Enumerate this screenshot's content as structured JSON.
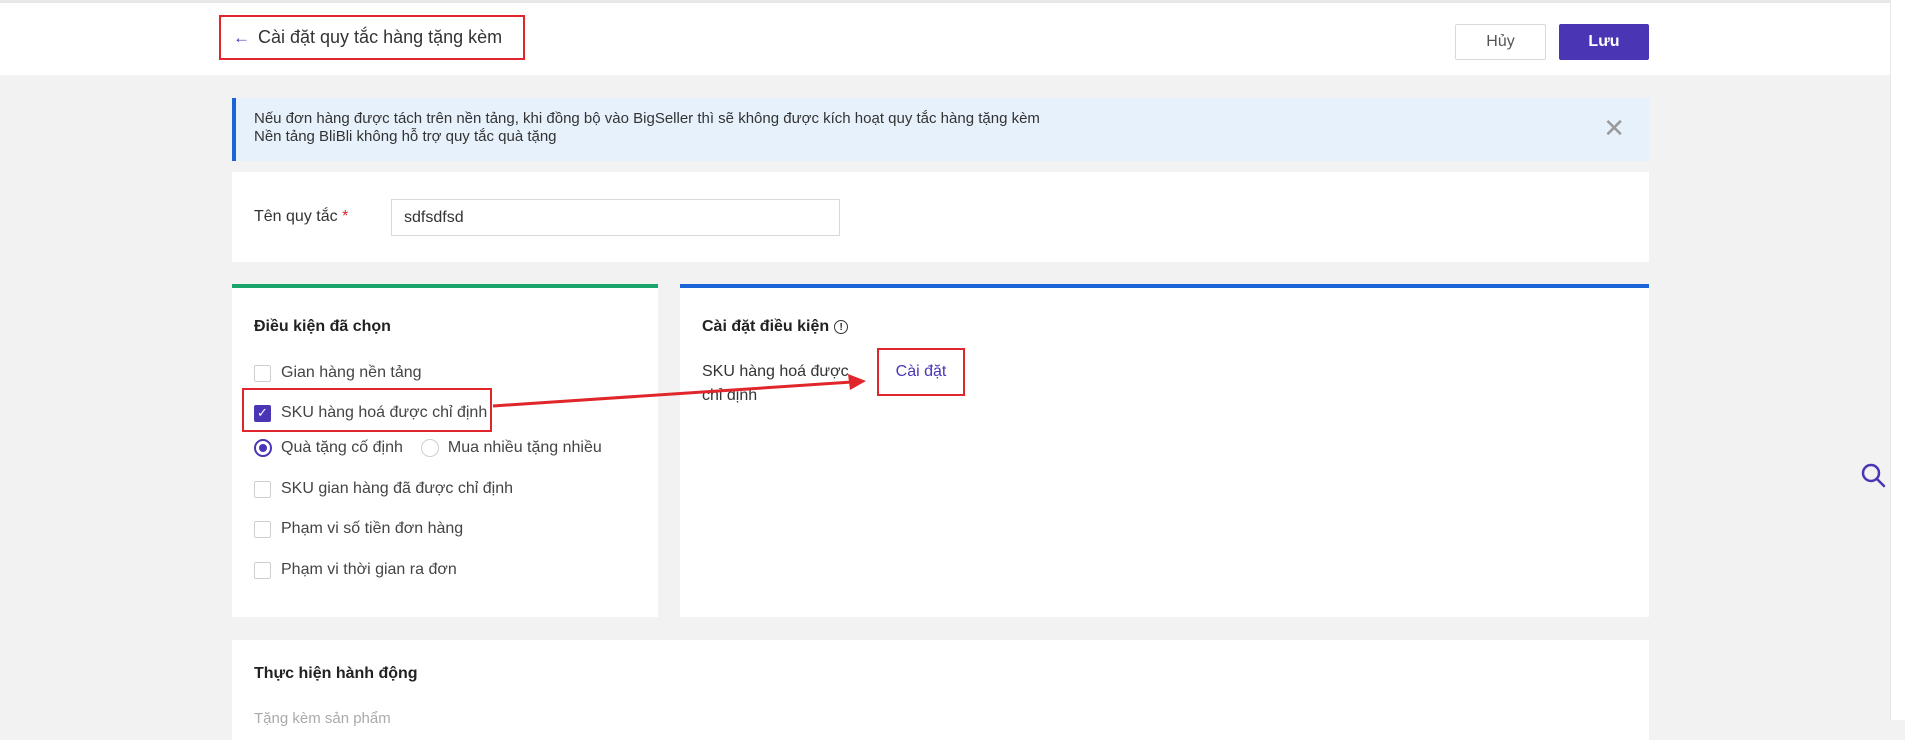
{
  "header": {
    "title": "Cài đặt quy tắc hàng tặng kèm",
    "cancel_label": "Hủy",
    "save_label": "Lưu"
  },
  "notice": {
    "line1": "Nếu đơn hàng được tách trên nền tảng, khi đồng bộ vào BigSeller thì sẽ không được kích hoạt quy tắc hàng tặng kèm",
    "line2": "Nền tảng BliBli không hỗ trợ quy tắc quà tặng",
    "close_icon": "close-icon"
  },
  "rule_name": {
    "label": "Tên quy tắc",
    "required_mark": "*",
    "value": "sdfsdfsd"
  },
  "conditions": {
    "title": "Điều kiện đã chọn",
    "items": [
      {
        "label": "Gian hàng nền tảng",
        "checked": false
      },
      {
        "label": "SKU hàng hoá được chỉ định",
        "checked": true
      },
      {
        "label": "SKU gian hàng đã được chỉ định",
        "checked": false
      },
      {
        "label": "Phạm vi số tiền đơn hàng",
        "checked": false
      },
      {
        "label": "Phạm vi thời gian ra đơn",
        "checked": false
      }
    ],
    "radios": [
      {
        "label": "Quà tặng cố định",
        "selected": true
      },
      {
        "label": "Mua nhiều tặng nhiều",
        "selected": false
      }
    ]
  },
  "condition_settings": {
    "title": "Cài đặt điều kiện",
    "sku_label": "SKU hàng hoá được chỉ định",
    "setting_link": "Cài đặt"
  },
  "action": {
    "title": "Thực hiện hành động",
    "sub": "Tặng kèm sản phẩm"
  },
  "colors": {
    "primary": "#4a36b5",
    "highlight": "#e0262b",
    "green_accent": "#1aa66b",
    "blue_accent": "#1a64d8"
  }
}
